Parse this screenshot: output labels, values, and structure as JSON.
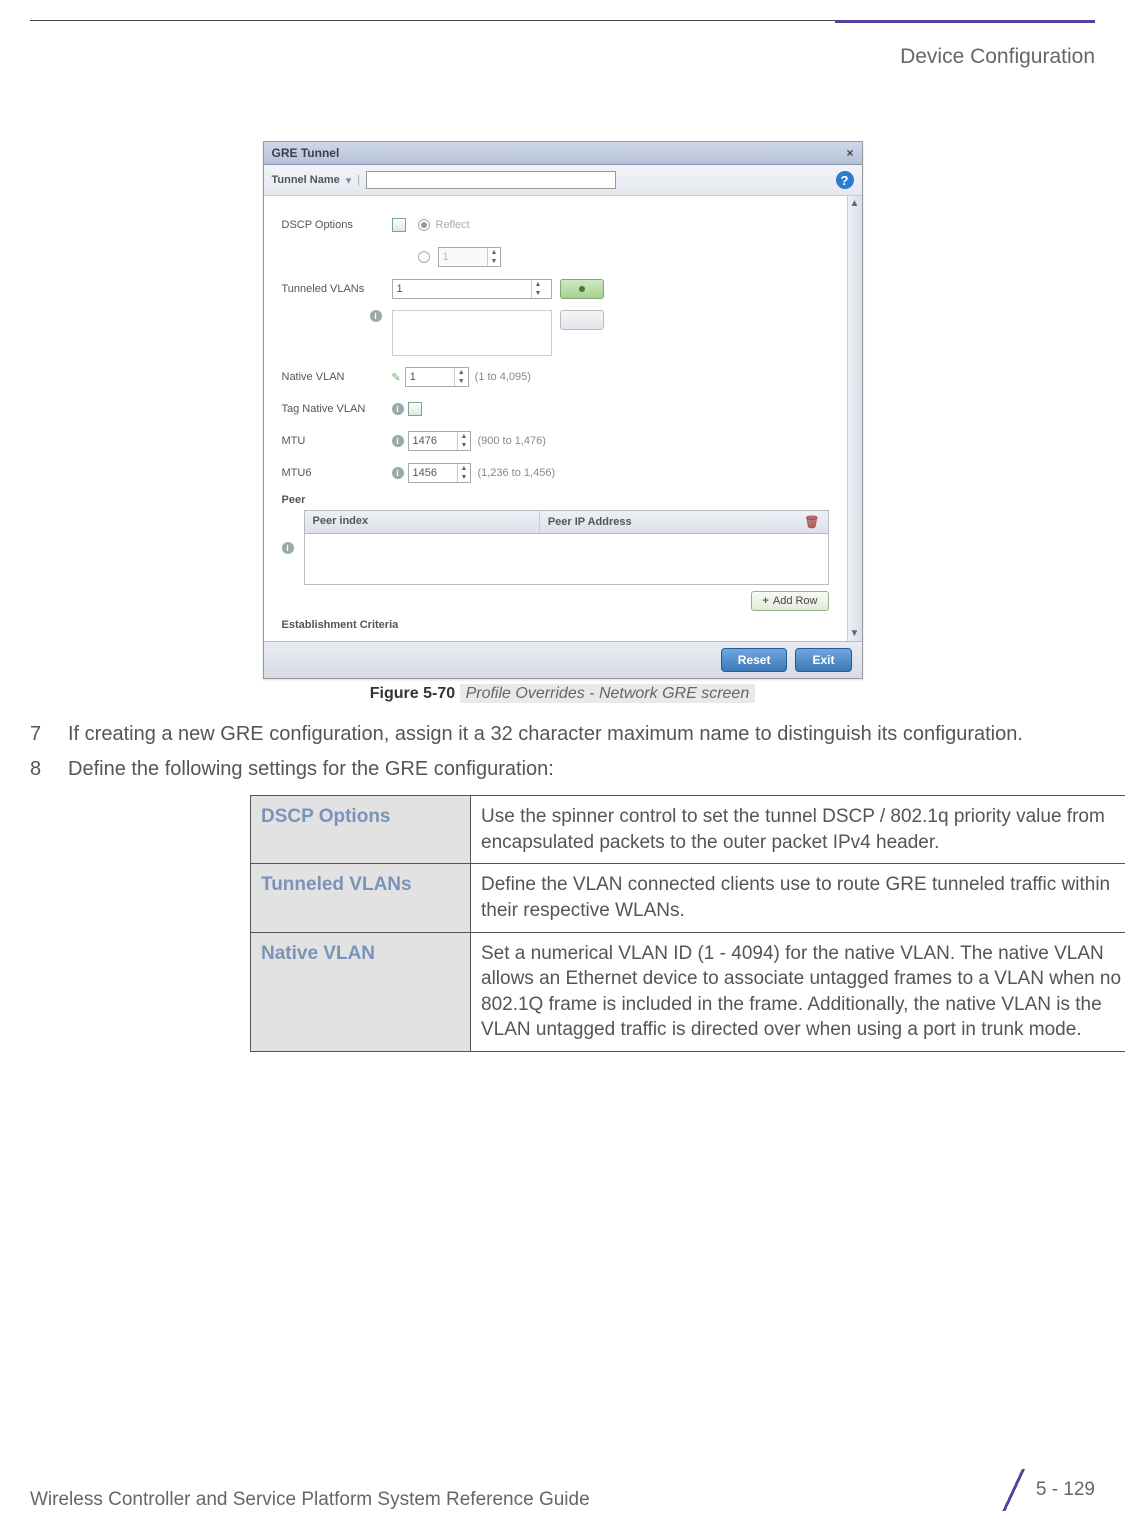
{
  "header": {
    "section_label": "Device Configuration"
  },
  "screenshot": {
    "titlebar": "GRE Tunnel",
    "tunnel_name_label": "Tunnel Name",
    "help_tooltip_char": "?",
    "fields": {
      "dscp_options": {
        "label": "DSCP Options",
        "radio_reflect": "Reflect",
        "spinner_value": "1"
      },
      "tunneled_vlans": {
        "label": "Tunneled VLANs",
        "spinner_value": "1"
      },
      "native_vlan": {
        "label": "Native VLAN",
        "spinner_value": "1",
        "hint": "(1 to 4,095)"
      },
      "tag_native_vlan": {
        "label": "Tag Native VLAN"
      },
      "mtu": {
        "label": "MTU",
        "spinner_value": "1476",
        "hint": "(900 to 1,476)"
      },
      "mtu6": {
        "label": "MTU6",
        "spinner_value": "1456",
        "hint": "(1,236 to 1,456)"
      }
    },
    "peer": {
      "section_label": "Peer",
      "col1": "Peer index",
      "col2": "Peer IP Address",
      "add_row": "Add Row"
    },
    "establishment_criteria": "Establishment Criteria",
    "footer": {
      "reset": "Reset",
      "exit": "Exit"
    }
  },
  "figure": {
    "number": "Figure 5-70",
    "caption": "Profile Overrides - Network GRE screen"
  },
  "steps": {
    "s7": {
      "num": "7",
      "text": "If creating a new GRE configuration, assign it a 32 character maximum name to distinguish its configuration."
    },
    "s8": {
      "num": "8",
      "text": "Define the following settings for the GRE configuration:"
    }
  },
  "definitions": {
    "dscp": {
      "term": "DSCP Options",
      "desc": "Use the spinner control to set the tunnel DSCP / 802.1q priority value from encapsulated packets to the outer packet IPv4 header."
    },
    "tunneled": {
      "term": "Tunneled VLANs",
      "desc": "Define the VLAN connected clients use to route GRE tunneled traffic within their respective WLANs."
    },
    "native": {
      "term": "Native VLAN",
      "desc": "Set a numerical VLAN ID (1 - 4094) for the native VLAN. The native VLAN allows an Ethernet device to associate untagged frames to a VLAN when no 802.1Q frame is included in the frame. Additionally, the native VLAN is the VLAN untagged traffic is directed over when using a port in trunk mode."
    }
  },
  "page_footer": {
    "doc_title": "Wireless Controller and Service Platform System Reference Guide",
    "page_number": "5 - 129"
  }
}
